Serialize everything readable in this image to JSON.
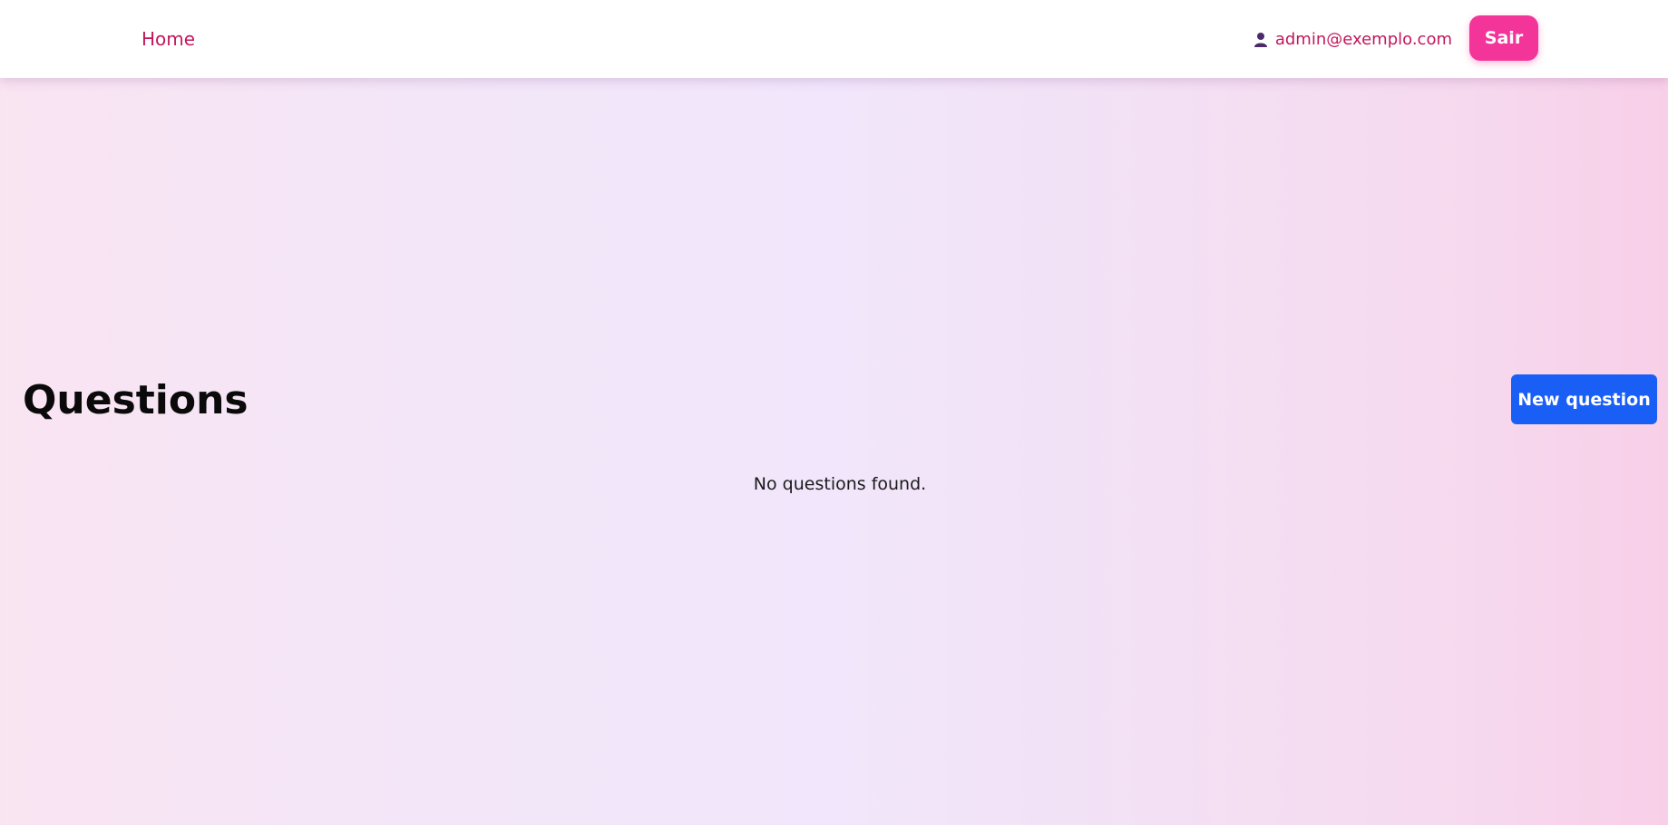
{
  "navbar": {
    "home_label": "Home",
    "user_icon": "user-icon",
    "user_email": "admin@exemplo.com",
    "logout_label": "Sair"
  },
  "main": {
    "title": "Questions",
    "new_button_label": "New question",
    "empty_message": "No questions found."
  },
  "colors": {
    "nav_link": "#c2185b",
    "logout_button": "#f33599",
    "primary_button": "#1a5ff5",
    "user_icon": "#4a2a6a"
  }
}
